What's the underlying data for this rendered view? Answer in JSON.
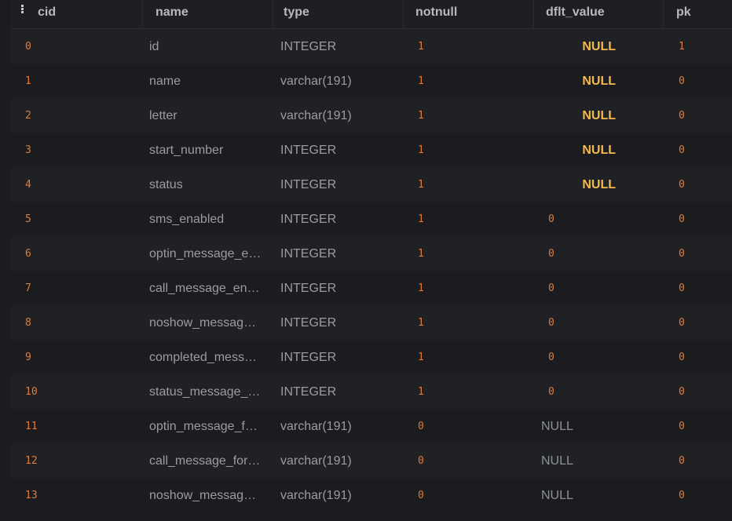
{
  "columns": [
    "cid",
    "name",
    "type",
    "notnull",
    "dflt_value",
    "pk"
  ],
  "rows": [
    {
      "cid": "0",
      "name": "id",
      "type": "INTEGER",
      "notnull": "1",
      "dflt_value": "NULL",
      "dflt_kind": "keyword",
      "pk": "1"
    },
    {
      "cid": "1",
      "name": "name",
      "type": "varchar(191)",
      "notnull": "1",
      "dflt_value": "NULL",
      "dflt_kind": "keyword",
      "pk": "0"
    },
    {
      "cid": "2",
      "name": "letter",
      "type": "varchar(191)",
      "notnull": "1",
      "dflt_value": "NULL",
      "dflt_kind": "keyword",
      "pk": "0"
    },
    {
      "cid": "3",
      "name": "start_number",
      "type": "INTEGER",
      "notnull": "1",
      "dflt_value": "NULL",
      "dflt_kind": "keyword",
      "pk": "0"
    },
    {
      "cid": "4",
      "name": "status",
      "type": "INTEGER",
      "notnull": "1",
      "dflt_value": "NULL",
      "dflt_kind": "keyword",
      "pk": "0"
    },
    {
      "cid": "5",
      "name": "sms_enabled",
      "type": "INTEGER",
      "notnull": "1",
      "dflt_value": "0",
      "dflt_kind": "number",
      "pk": "0"
    },
    {
      "cid": "6",
      "name": "optin_message_e…",
      "type": "INTEGER",
      "notnull": "1",
      "dflt_value": "0",
      "dflt_kind": "number",
      "pk": "0"
    },
    {
      "cid": "7",
      "name": "call_message_en…",
      "type": "INTEGER",
      "notnull": "1",
      "dflt_value": "0",
      "dflt_kind": "number",
      "pk": "0"
    },
    {
      "cid": "8",
      "name": "noshow_messag…",
      "type": "INTEGER",
      "notnull": "1",
      "dflt_value": "0",
      "dflt_kind": "number",
      "pk": "0"
    },
    {
      "cid": "9",
      "name": "completed_mess…",
      "type": "INTEGER",
      "notnull": "1",
      "dflt_value": "0",
      "dflt_kind": "number",
      "pk": "0"
    },
    {
      "cid": "10",
      "name": "status_message_…",
      "type": "INTEGER",
      "notnull": "1",
      "dflt_value": "0",
      "dflt_kind": "number",
      "pk": "0"
    },
    {
      "cid": "11",
      "name": "optin_message_f…",
      "type": "varchar(191)",
      "notnull": "0",
      "dflt_value": "NULL",
      "dflt_kind": "text",
      "pk": "0"
    },
    {
      "cid": "12",
      "name": "call_message_for…",
      "type": "varchar(191)",
      "notnull": "0",
      "dflt_value": "NULL",
      "dflt_kind": "text",
      "pk": "0"
    },
    {
      "cid": "13",
      "name": "noshow_messag…",
      "type": "varchar(191)",
      "notnull": "0",
      "dflt_value": "NULL",
      "dflt_kind": "text",
      "pk": "0"
    }
  ],
  "icons": {
    "column_menu": "menu-dots-icon"
  },
  "colors": {
    "background": "#1b1c1f",
    "row_alt": "#202125",
    "number": "#e07b39",
    "null_keyword": "#f5b84f",
    "text": "#9a9ca2"
  }
}
